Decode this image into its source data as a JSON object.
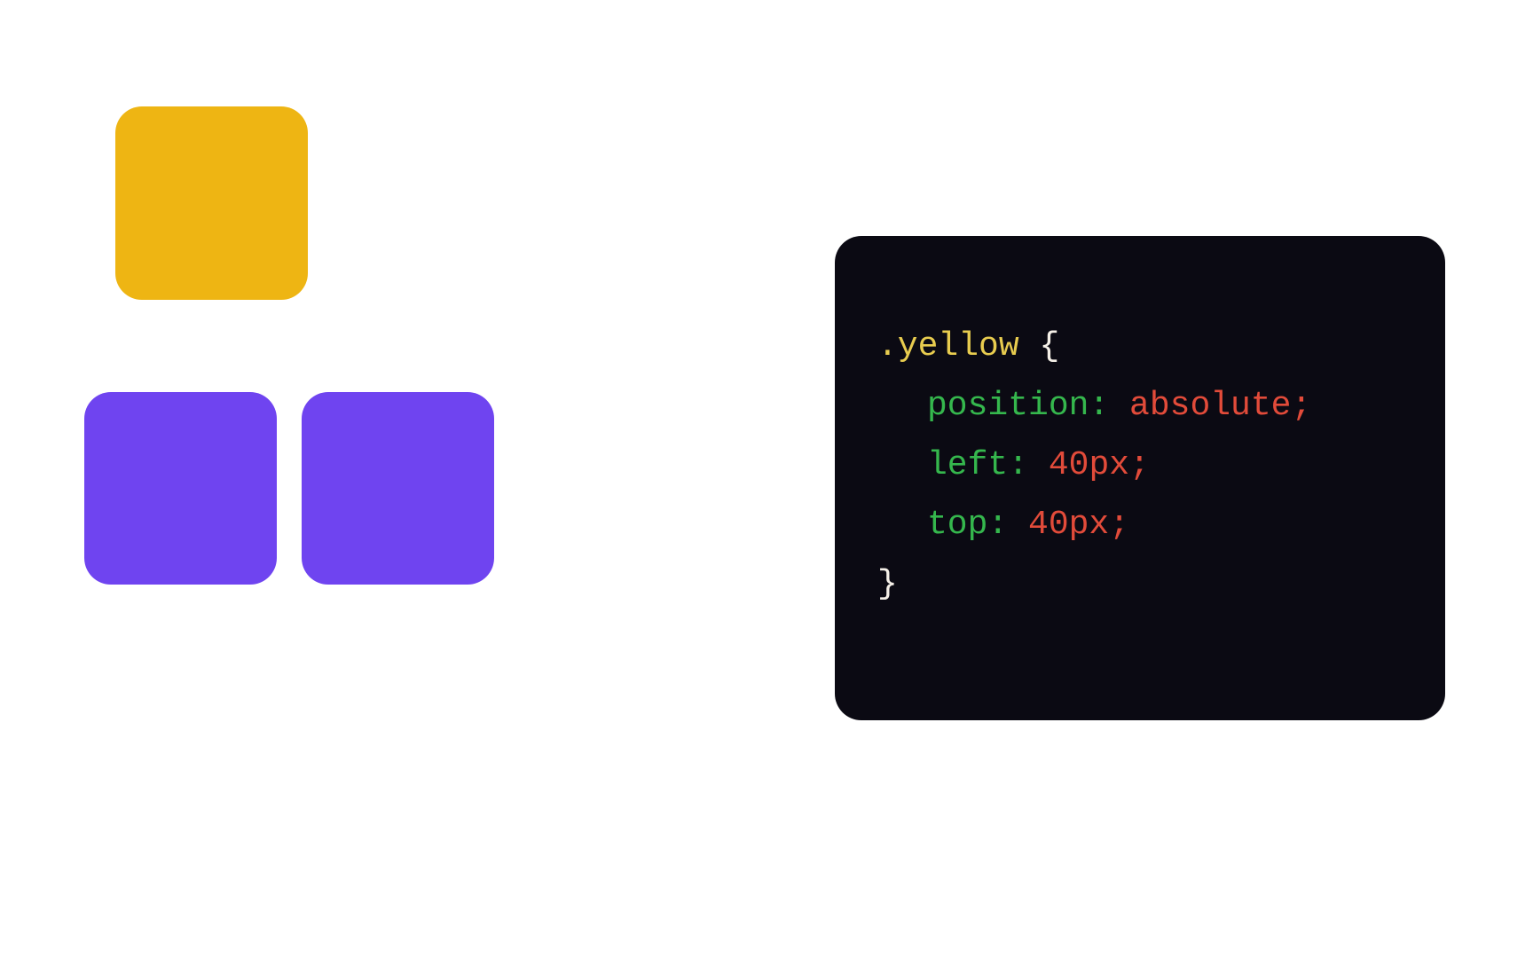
{
  "boxes": {
    "yellow_color": "#eeb513",
    "purple_color": "#6f44f0"
  },
  "code": {
    "selector": ".yellow",
    "brace_open": " {",
    "brace_close": "}",
    "prop1": "position:",
    "val1": " absolute;",
    "prop2": "left:",
    "val2": " 40px;",
    "prop3": "top:",
    "val3": " 40px;"
  }
}
